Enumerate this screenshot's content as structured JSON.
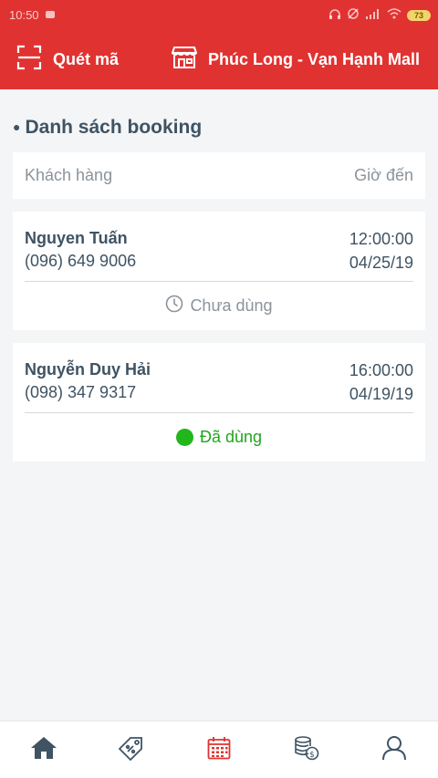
{
  "status_bar": {
    "time": "10:50",
    "battery": "73"
  },
  "app_bar": {
    "scan_label": "Quét mã",
    "store_name": "Phúc Long - Vạn Hạnh Mall"
  },
  "section": {
    "title": "Danh sách booking"
  },
  "table_header": {
    "customer": "Khách hàng",
    "arrival_time": "Giờ đến"
  },
  "bookings": [
    {
      "name": "Nguyen Tuấn",
      "phone": "(096) 649 9006",
      "time": "12:00:00",
      "date": "04/25/19",
      "status": "Chưa dùng"
    },
    {
      "name": "Nguyễn Duy Hải",
      "phone": "(098) 347 9317",
      "time": "16:00:00",
      "date": "04/19/19",
      "status": "Đã dùng"
    }
  ],
  "bottom_nav": [
    {
      "icon": "home-icon"
    },
    {
      "icon": "promotion-tag-icon"
    },
    {
      "icon": "calendar-icon",
      "active": true
    },
    {
      "icon": "coins-icon"
    },
    {
      "icon": "user-icon"
    }
  ],
  "colors": {
    "primary": "#e03331",
    "text": "#3f5363",
    "muted": "#8b939a",
    "success": "#22b61d",
    "background": "#f4f5f6"
  }
}
